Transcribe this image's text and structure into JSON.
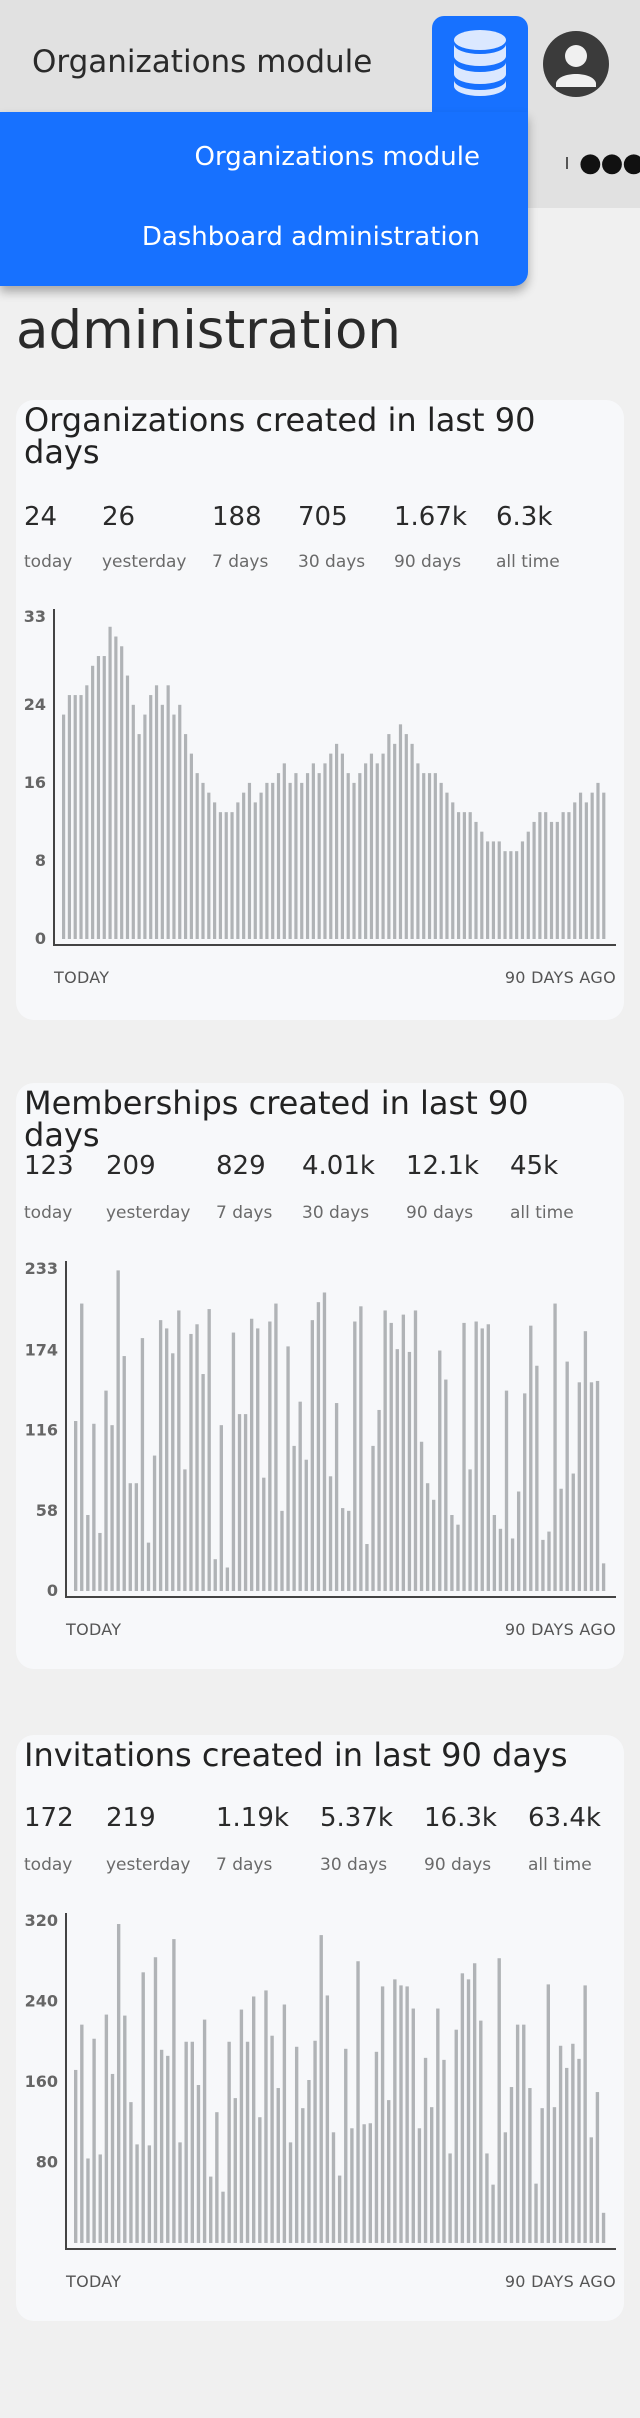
{
  "header": {
    "module_title": "Organizations module",
    "database_icon": "database-icon",
    "avatar_icon": "user-avatar-icon",
    "more_icon": "more-dots-icon",
    "accent_color": "#1771ff"
  },
  "menu": {
    "items": [
      {
        "label": "Organizations module"
      },
      {
        "label": "Dashboard administration"
      }
    ]
  },
  "page": {
    "heading": "administration"
  },
  "cards": [
    {
      "title": "Organizations created in last 90 days",
      "stats": [
        {
          "value": "24",
          "label": "today"
        },
        {
          "value": "26",
          "label": "yesterday"
        },
        {
          "value": "188",
          "label": "7 days"
        },
        {
          "value": "705",
          "label": "30 days"
        },
        {
          "value": "1.67k",
          "label": "90 days"
        },
        {
          "value": "6.3k",
          "label": "all time"
        }
      ],
      "x_start_label": "TODAY",
      "x_end_label": "90 DAYS AGO"
    },
    {
      "title": "Memberships created in last 90 days",
      "stats": [
        {
          "value": "123",
          "label": "today"
        },
        {
          "value": "209",
          "label": "yesterday"
        },
        {
          "value": "829",
          "label": "7 days"
        },
        {
          "value": "4.01k",
          "label": "30 days"
        },
        {
          "value": "12.1k",
          "label": "90 days"
        },
        {
          "value": "45k",
          "label": "all time"
        }
      ],
      "x_start_label": "TODAY",
      "x_end_label": "90 DAYS AGO"
    },
    {
      "title": "Invitations created in last 90 days",
      "stats": [
        {
          "value": "172",
          "label": "today"
        },
        {
          "value": "219",
          "label": "yesterday"
        },
        {
          "value": "1.19k",
          "label": "7 days"
        },
        {
          "value": "5.37k",
          "label": "30 days"
        },
        {
          "value": "16.3k",
          "label": "90 days"
        },
        {
          "value": "63.4k",
          "label": "all time"
        }
      ],
      "x_start_label": "TODAY",
      "x_end_label": "90 DAYS AGO"
    }
  ],
  "chart_data": [
    {
      "type": "bar",
      "ticks": [
        "0",
        "8",
        "16",
        "24",
        "33"
      ],
      "ylim": [
        0,
        33
      ],
      "bar_color": "#b0b3b6",
      "values": [
        23,
        25,
        25,
        25,
        26,
        28,
        29,
        29,
        32,
        31,
        30,
        27,
        24,
        21,
        23,
        25,
        26,
        24,
        26,
        23,
        24,
        21,
        19,
        17,
        16,
        15,
        14,
        13,
        13,
        13,
        14,
        15,
        16,
        14,
        15,
        16,
        16,
        17,
        18,
        16,
        17,
        16,
        17,
        18,
        17,
        18,
        19,
        20,
        19,
        17,
        16,
        17,
        18,
        19,
        18,
        19,
        21,
        20,
        22,
        21,
        20,
        18,
        17,
        17,
        17,
        16,
        15,
        14,
        13,
        13,
        13,
        12,
        11,
        10,
        10,
        10,
        9,
        9,
        9,
        10,
        11,
        12,
        13,
        13,
        12,
        12,
        13,
        13,
        14,
        15,
        14,
        15,
        16,
        15
      ]
    },
    {
      "type": "bar",
      "ticks": [
        "0",
        "58",
        "116",
        "174",
        "233"
      ],
      "ylim": [
        0,
        233
      ],
      "bar_color": "#b0b3b6",
      "values": [
        123,
        208,
        55,
        121,
        42,
        145,
        120,
        232,
        170,
        78,
        78,
        183,
        35,
        98,
        196,
        190,
        172,
        203,
        88,
        186,
        193,
        157,
        204,
        23,
        120,
        17,
        187,
        128,
        128,
        197,
        190,
        82,
        195,
        208,
        58,
        177,
        105,
        137,
        95,
        196,
        209,
        216,
        83,
        136,
        60,
        58,
        195,
        206,
        34,
        105,
        131,
        203,
        194,
        175,
        200,
        173,
        203,
        108,
        78,
        66,
        174,
        153,
        55,
        48,
        194,
        88,
        195,
        190,
        193,
        55,
        45,
        145,
        38,
        72,
        143,
        192,
        163,
        37,
        43,
        208,
        74,
        166,
        85,
        151,
        188,
        151,
        152,
        20
      ]
    },
    {
      "type": "bar",
      "ticks": [
        "80",
        "160",
        "240",
        "320"
      ],
      "ylim": [
        0,
        320
      ],
      "bar_color": "#b0b3b6",
      "values": [
        172,
        217,
        84,
        203,
        88,
        227,
        168,
        317,
        226,
        140,
        98,
        269,
        97,
        284,
        192,
        186,
        302,
        100,
        200,
        200,
        157,
        222,
        66,
        130,
        51,
        200,
        144,
        232,
        200,
        245,
        125,
        251,
        206,
        154,
        237,
        100,
        195,
        134,
        162,
        201,
        306,
        246,
        110,
        67,
        193,
        114,
        280,
        118,
        119,
        190,
        255,
        142,
        262,
        256,
        255,
        233,
        114,
        184,
        135,
        233,
        182,
        89,
        212,
        268,
        262,
        278,
        221,
        89,
        58,
        283,
        110,
        155,
        217,
        217,
        154,
        59,
        134,
        257,
        135,
        196,
        174,
        198,
        183,
        256,
        105,
        150,
        30
      ]
    }
  ]
}
